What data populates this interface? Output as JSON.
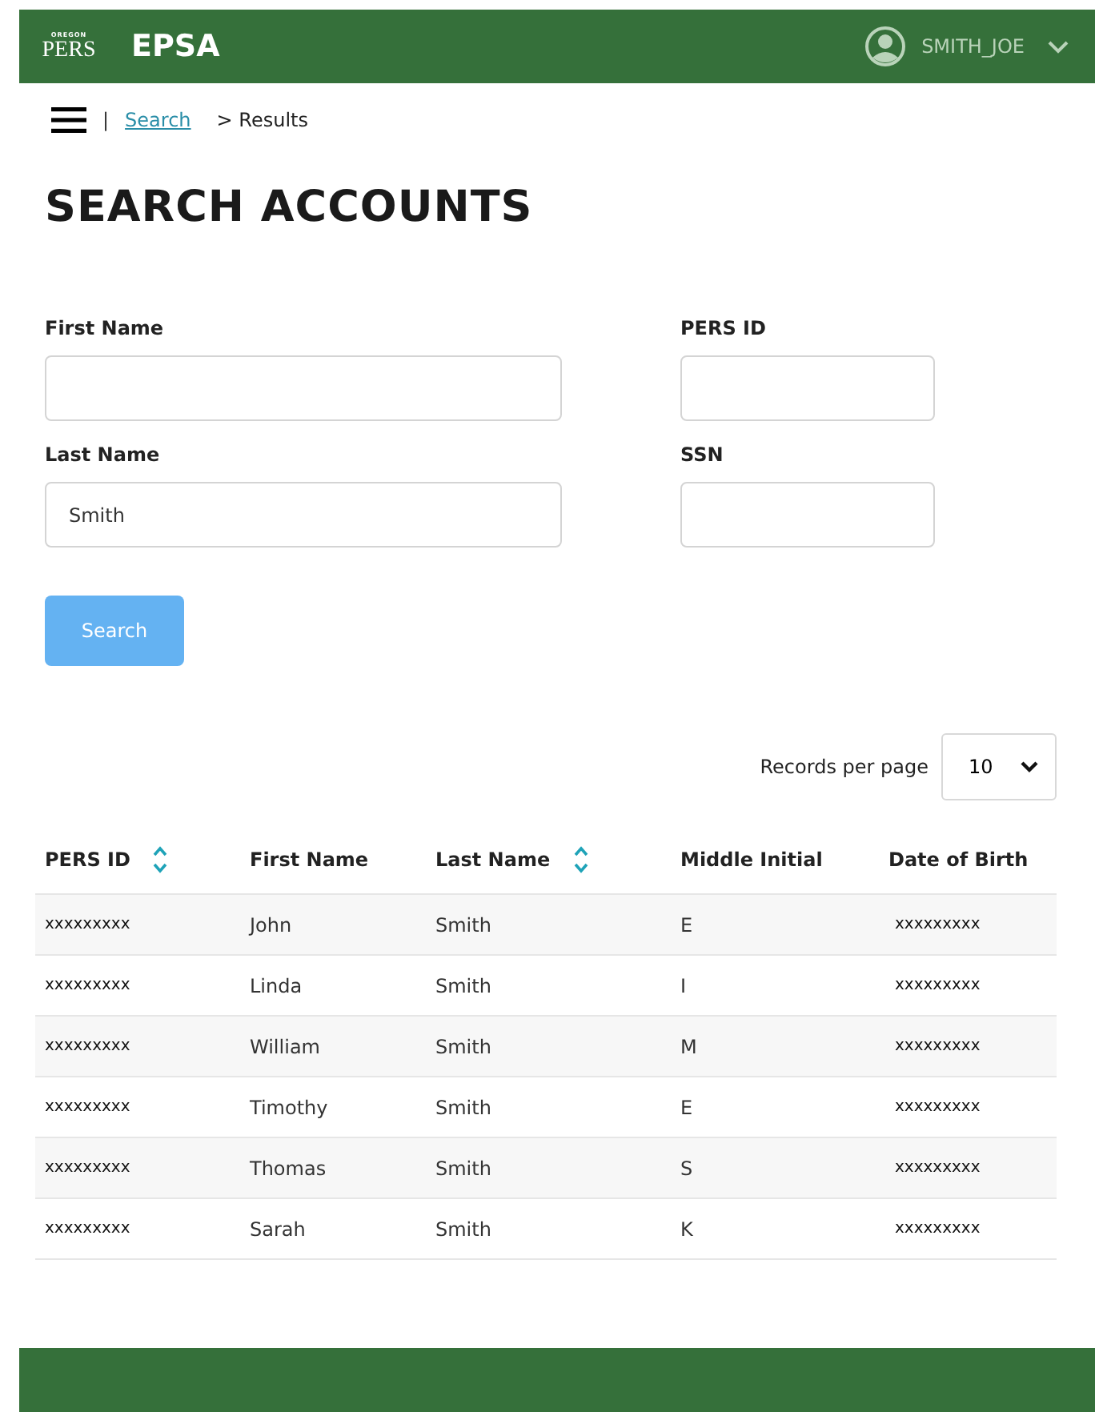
{
  "header": {
    "logo_top": "OREGON",
    "logo_main": "PERS",
    "app_name": "EPSA",
    "user": "SMITH_JOE"
  },
  "breadcrumb": {
    "separator": "|",
    "link": "Search",
    "current": "> Results"
  },
  "title": "SEARCH ACCOUNTS",
  "fields": [
    {
      "label": "First Name"
    },
    {
      "label": "PERS ID"
    },
    {
      "label": "Last Name",
      "value": "Smith"
    },
    {
      "label": "SSN"
    }
  ],
  "search_button": {
    "label": "Search",
    "disabled": true
  },
  "records_per_page": {
    "label": "Records per page",
    "value": "10"
  },
  "table": {
    "columns": [
      {
        "label": "PERS ID",
        "sortable": true
      },
      {
        "label": "First Name",
        "sortable": false
      },
      {
        "label": "Last Name",
        "sortable": true
      },
      {
        "label": "Middle Initial",
        "sortable": false
      },
      {
        "label": "Date of Birth",
        "sortable": false
      }
    ],
    "rows": [
      [
        "xxxxxxxxx",
        "John",
        "Smith",
        "E",
        "xxxxxxxxx"
      ],
      [
        "xxxxxxxxx",
        "Linda",
        "Smith",
        "I",
        "xxxxxxxxx"
      ],
      [
        "xxxxxxxxx",
        "William",
        "Smith",
        "M",
        "xxxxxxxxx"
      ],
      [
        "xxxxxxxxx",
        "Timothy",
        "Smith",
        "E",
        "xxxxxxxxx"
      ],
      [
        "xxxxxxxxx",
        "Thomas",
        "Smith",
        "S",
        "xxxxxxxxx"
      ],
      [
        "xxxxxxxxx",
        "Sarah",
        "Smith",
        "K",
        "xxxxxxxxx"
      ]
    ]
  }
}
